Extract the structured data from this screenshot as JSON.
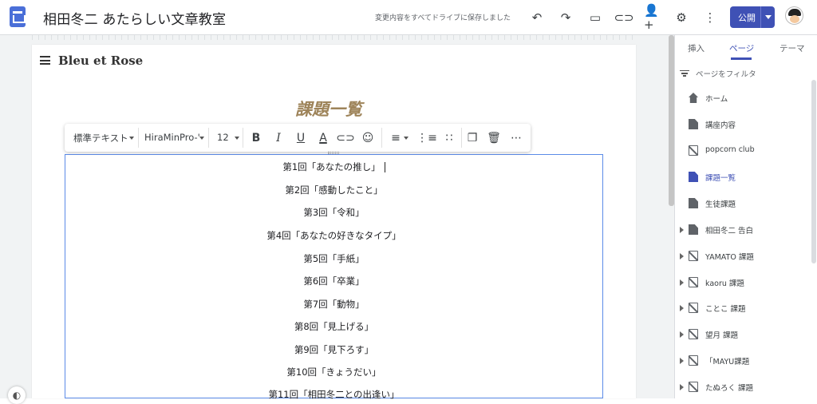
{
  "topbar": {
    "site_title": "相田冬二 あたらしい文章教室",
    "save_status": "変更内容をすべてドライブに保存しました",
    "icons": [
      "undo-icon",
      "redo-icon",
      "preview-icon",
      "link-icon",
      "share-icon",
      "settings-icon",
      "more-vert-icon"
    ],
    "publish_label": "公開"
  },
  "page": {
    "brand": "Bleu et Rose",
    "heading": "課題一覧"
  },
  "format_toolbar": {
    "style_select": "標準テキスト",
    "font_select": "HiraMinPro-'",
    "size_select": "12",
    "buttons": [
      "bold",
      "italic",
      "underline",
      "text-color",
      "link",
      "emoji",
      "align",
      "numbered-list",
      "bulleted-list",
      "copy",
      "delete",
      "more"
    ]
  },
  "lessons": [
    "第1回「あなたの推し」",
    "第2回「感動したこと」",
    "第3回「令和」",
    "第4回「あなたの好きなタイプ」",
    "第5回「手紙」",
    "第6回「卒業」",
    "第7回「動物」",
    "第8回「見上げる」",
    "第9回「見下ろす」",
    "第10回「きょうだい」",
    "第11回「相田冬二との出逢い」"
  ],
  "panel": {
    "tabs": [
      "挿入",
      "ページ",
      "テーマ"
    ],
    "filter_label": "ページをフィルタ",
    "pages": [
      {
        "label": "ホーム",
        "icon": "home-icon",
        "expand": false
      },
      {
        "label": "講座内容",
        "icon": "doc-icon",
        "expand": false
      },
      {
        "label": "popcorn club",
        "icon": "hidden-page-icon",
        "expand": false
      },
      {
        "label": "課題一覧",
        "icon": "doc-icon",
        "expand": false,
        "active": true
      },
      {
        "label": "生徒課題",
        "icon": "doc-icon",
        "expand": false
      },
      {
        "label": "相田冬二 告白",
        "icon": "doc-icon",
        "expand": true
      },
      {
        "label": "YAMATO 課題",
        "icon": "hidden-page-icon",
        "expand": true
      },
      {
        "label": "kaoru 課題",
        "icon": "hidden-page-icon",
        "expand": true
      },
      {
        "label": "ことこ 課題",
        "icon": "hidden-page-icon",
        "expand": true
      },
      {
        "label": "望月 課題",
        "icon": "hidden-page-icon",
        "expand": true
      },
      {
        "label": "「MAYU課題",
        "icon": "hidden-page-icon",
        "expand": true
      },
      {
        "label": "たぬろく 課題",
        "icon": "hidden-page-icon",
        "expand": true
      }
    ]
  }
}
